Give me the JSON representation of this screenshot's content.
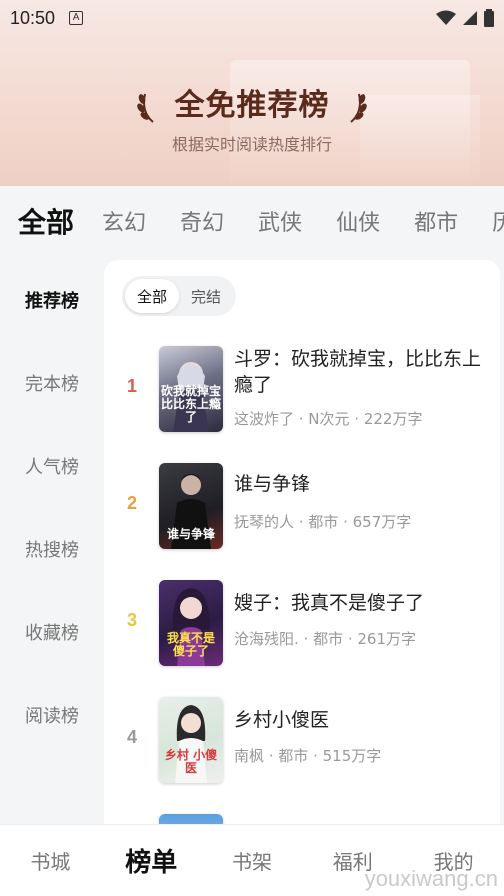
{
  "status_bar": {
    "time": "10:50",
    "notification_icon": "A"
  },
  "hero": {
    "title": "全免推荐榜",
    "subtitle": "根据实时阅读热度排行"
  },
  "categories": [
    "全部",
    "玄幻",
    "奇幻",
    "武侠",
    "仙侠",
    "都市",
    "历"
  ],
  "side_menu": [
    "推荐榜",
    "完本榜",
    "人气榜",
    "热搜榜",
    "收藏榜",
    "阅读榜"
  ],
  "segment": [
    "全部",
    "完结"
  ],
  "books": [
    {
      "rank": "1",
      "title": "斗罗：砍我就掉宝，比比东上瘾了",
      "meta": "这波炸了 · N次元 · 222万字",
      "cover_text": "砍我就掉宝 比比东上瘾了",
      "rank_color": "#e05a4f"
    },
    {
      "rank": "2",
      "title": "谁与争锋",
      "meta": "抚琴的人 · 都市 · 657万字",
      "cover_text": "谁与争锋",
      "rank_color": "#e8a040"
    },
    {
      "rank": "3",
      "title": "嫂子：我真不是傻子了",
      "meta": "沧海残阳. · 都市 · 261万字",
      "cover_text": "我真不是 傻子了",
      "rank_color": "#e8c83a"
    },
    {
      "rank": "4",
      "title": "乡村小傻医",
      "meta": "南枫 · 都市 · 515万字",
      "cover_text": "乡村 小傻医",
      "rank_color": "#999999"
    }
  ],
  "bottom_nav": [
    "书城",
    "榜单",
    "书架",
    "福利",
    "我的"
  ],
  "watermark": "youxiwang.cn"
}
